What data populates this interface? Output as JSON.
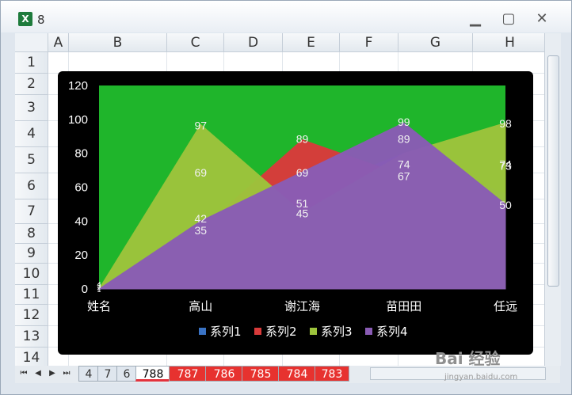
{
  "window": {
    "title": "8",
    "icon": "excel-icon",
    "controls": [
      "minimize-icon",
      "maximize-icon",
      "close-icon"
    ]
  },
  "sheet": {
    "columns": [
      "A",
      "B",
      "C",
      "D",
      "E",
      "F",
      "G",
      "H"
    ],
    "rows": [
      "1",
      "2",
      "3",
      "4",
      "5",
      "6",
      "7",
      "8",
      "9",
      "10",
      "11",
      "12",
      "13",
      "14"
    ]
  },
  "tabs": {
    "nav": [
      "⏮",
      "◀",
      "▶",
      "⏭"
    ],
    "items": [
      "4",
      "7",
      "6",
      "788",
      "787",
      "786",
      "785",
      "784",
      "783"
    ],
    "active": "788"
  },
  "chart_data": {
    "type": "area",
    "categories": [
      "姓名",
      "高山",
      "谢江海",
      "苗田田",
      "任远"
    ],
    "ylim": [
      0,
      120
    ],
    "yticks": [
      "0",
      "20",
      "40",
      "60",
      "80",
      "100",
      "120"
    ],
    "legend_position": "bottom",
    "plot_background": "#1fb52b",
    "chart_background": "#000000",
    "series": [
      {
        "name": "系列1",
        "color": "#3a73c4",
        "values": [
          1,
          42,
          51,
          74,
          73
        ]
      },
      {
        "name": "系列2",
        "color": "#d93b3b",
        "values": [
          2,
          35,
          89,
          67,
          74
        ]
      },
      {
        "name": "系列3",
        "color": "#9dc43c",
        "values": [
          3,
          97,
          45,
          89,
          98
        ]
      },
      {
        "name": "系列4",
        "color": "#8a5cb5",
        "values": [
          4,
          69,
          69,
          99,
          50
        ]
      }
    ],
    "plotted": {
      "系列1": [
        0,
        40,
        56,
        80,
        56
      ],
      "系列2": [
        0,
        35,
        88,
        67,
        50
      ],
      "系列3": [
        0,
        97,
        45,
        80,
        98
      ],
      "系列4": [
        0,
        40,
        69,
        98,
        50
      ]
    }
  },
  "watermark": {
    "text": "Bai 经验",
    "sub": "jingyan.baidu.com"
  }
}
